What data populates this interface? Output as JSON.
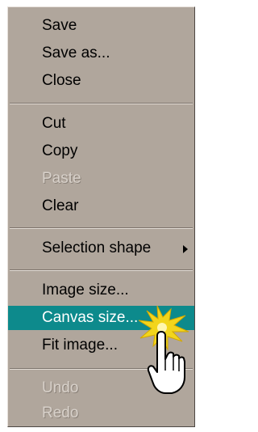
{
  "menu": {
    "items": [
      {
        "label": "Save",
        "enabled": true
      },
      {
        "label": "Save as...",
        "enabled": true
      },
      {
        "label": "Close",
        "enabled": true
      },
      {
        "label": "Cut",
        "enabled": true
      },
      {
        "label": "Copy",
        "enabled": true
      },
      {
        "label": "Paste",
        "enabled": false
      },
      {
        "label": "Clear",
        "enabled": true
      },
      {
        "label": "Selection shape",
        "enabled": true,
        "has_submenu": true
      },
      {
        "label": "Image size...",
        "enabled": true
      },
      {
        "label": "Canvas size...",
        "enabled": true,
        "highlighted": true
      },
      {
        "label": "Fit image...",
        "enabled": true
      },
      {
        "label": "Undo",
        "enabled": false
      },
      {
        "label": "Redo",
        "enabled": false
      }
    ]
  },
  "colors": {
    "menu_background": "#b0a69c",
    "highlight": "#0d8a8c",
    "disabled_text": "#d8d1ca",
    "click_burst": "#f2d51c"
  },
  "icons": {
    "submenu": "submenu-arrow-icon",
    "pointer": "hand-pointer-cursor-icon",
    "click": "click-burst-icon"
  }
}
